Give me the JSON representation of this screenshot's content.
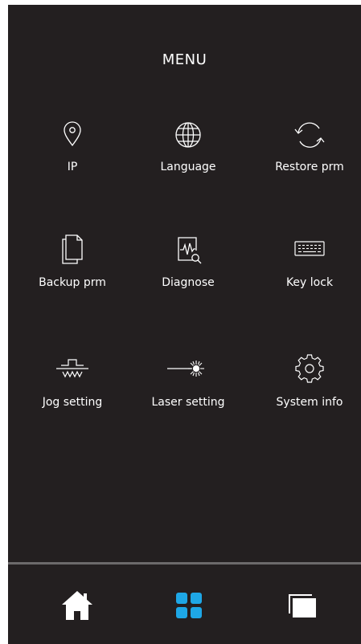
{
  "header": {
    "title": "MENU"
  },
  "menu": {
    "items": [
      {
        "label": "IP",
        "icon": "location-pin-icon"
      },
      {
        "label": "Language",
        "icon": "globe-icon"
      },
      {
        "label": "Restore prm",
        "icon": "refresh-icon"
      },
      {
        "label": "Backup prm",
        "icon": "copy-documents-icon"
      },
      {
        "label": "Diagnose",
        "icon": "diagnose-waveform-icon"
      },
      {
        "label": "Key lock",
        "icon": "keyboard-icon"
      },
      {
        "label": "Jog setting",
        "icon": "jog-pulse-icon"
      },
      {
        "label": "Laser setting",
        "icon": "laser-beam-icon"
      },
      {
        "label": "System info",
        "icon": "gear-icon"
      }
    ]
  },
  "nav": {
    "home": {
      "icon": "home-icon"
    },
    "menu": {
      "icon": "grid-menu-icon",
      "active": true
    },
    "windows": {
      "icon": "windows-stack-icon"
    }
  },
  "colors": {
    "background": "#231f20",
    "text": "#ffffff",
    "accent": "#1ea7e6",
    "divider": "#6c6a6b"
  }
}
